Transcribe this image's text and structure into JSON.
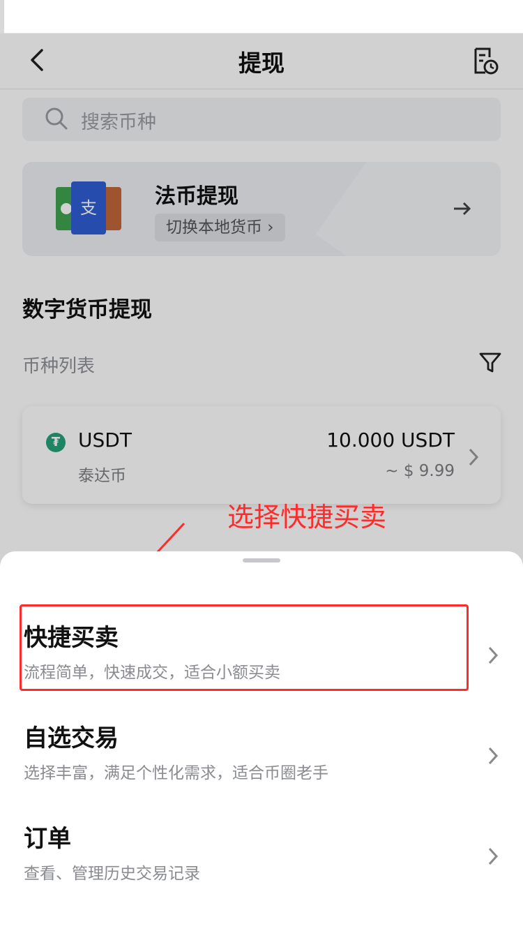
{
  "header": {
    "title": "提现"
  },
  "search": {
    "placeholder": "搜索币种"
  },
  "fiat": {
    "title": "法币提现",
    "switch_label": "切换本地货币 ›"
  },
  "crypto_section": {
    "title": "数字货币提现",
    "list_label": "币种列表"
  },
  "coins": [
    {
      "symbol": "USDT",
      "name": "泰达币",
      "amount": "10.000 USDT",
      "usd": "~ $ 9.99"
    }
  ],
  "annotation": {
    "text": "选择快捷买卖",
    "color": "#ff2a2a"
  },
  "sheet": {
    "options": [
      {
        "title": "快捷买卖",
        "subtitle": "流程简单，快速成交，适合小额买卖"
      },
      {
        "title": "自选交易",
        "subtitle": "选择丰富，满足个性化需求，适合币圈老手"
      },
      {
        "title": "订单",
        "subtitle": "查看、管理历史交易记录"
      }
    ]
  },
  "icons": [
    "back-icon",
    "history-icon",
    "search-icon",
    "arrow-right-icon",
    "filter-icon",
    "chevron-right-icon",
    "tether-icon"
  ]
}
